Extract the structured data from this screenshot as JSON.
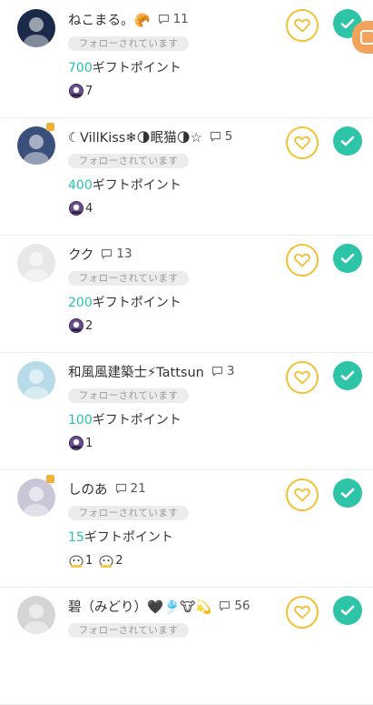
{
  "follow_label": "フォローされています",
  "gift_suffix": "ギフトポイント",
  "icons": {
    "heart": "heart-icon",
    "check": "check-icon",
    "comment": "comment-icon"
  },
  "colors": {
    "accent_teal": "#2ec4a7",
    "gift_number": "#28c2b0",
    "heart_border": "#f3c033",
    "pill_bg": "#ececec"
  },
  "users": [
    {
      "name": "ねこまる。🥐",
      "comments": "11",
      "gift_points": "700",
      "items": [
        {
          "icon": "stamp-item-icon",
          "count": "7"
        }
      ],
      "has_badge": false,
      "avatar_color": "#1b2a4a"
    },
    {
      "name": "☾VillKiss❄🌗眠猫🌗☆",
      "comments": "5",
      "gift_points": "400",
      "items": [
        {
          "icon": "stamp-item-icon",
          "count": "4"
        }
      ],
      "has_badge": true,
      "avatar_color": "#3a4f7a"
    },
    {
      "name": "クク",
      "comments": "13",
      "gift_points": "200",
      "items": [
        {
          "icon": "stamp-item-icon",
          "count": "2"
        }
      ],
      "has_badge": false,
      "avatar_color": "#e8e8e8"
    },
    {
      "name": "和風風建築士⚡Tattsun",
      "comments": "3",
      "gift_points": "100",
      "items": [
        {
          "icon": "stamp-item-icon",
          "count": "1"
        }
      ],
      "has_badge": false,
      "avatar_color": "#b7dbe9"
    },
    {
      "name": "しのあ",
      "comments": "21",
      "gift_points": "15",
      "items": [
        {
          "icon": "cow-stamp-icon",
          "count": "1"
        },
        {
          "icon": "cow-stamp-icon",
          "count": "2"
        }
      ],
      "has_badge": true,
      "avatar_color": "#c9c6d8"
    },
    {
      "name": "碧（みどり）🖤🎐🐮💫",
      "comments": "56",
      "gift_points": "",
      "items": [],
      "has_badge": false,
      "avatar_color": "#d5d5d5"
    }
  ]
}
